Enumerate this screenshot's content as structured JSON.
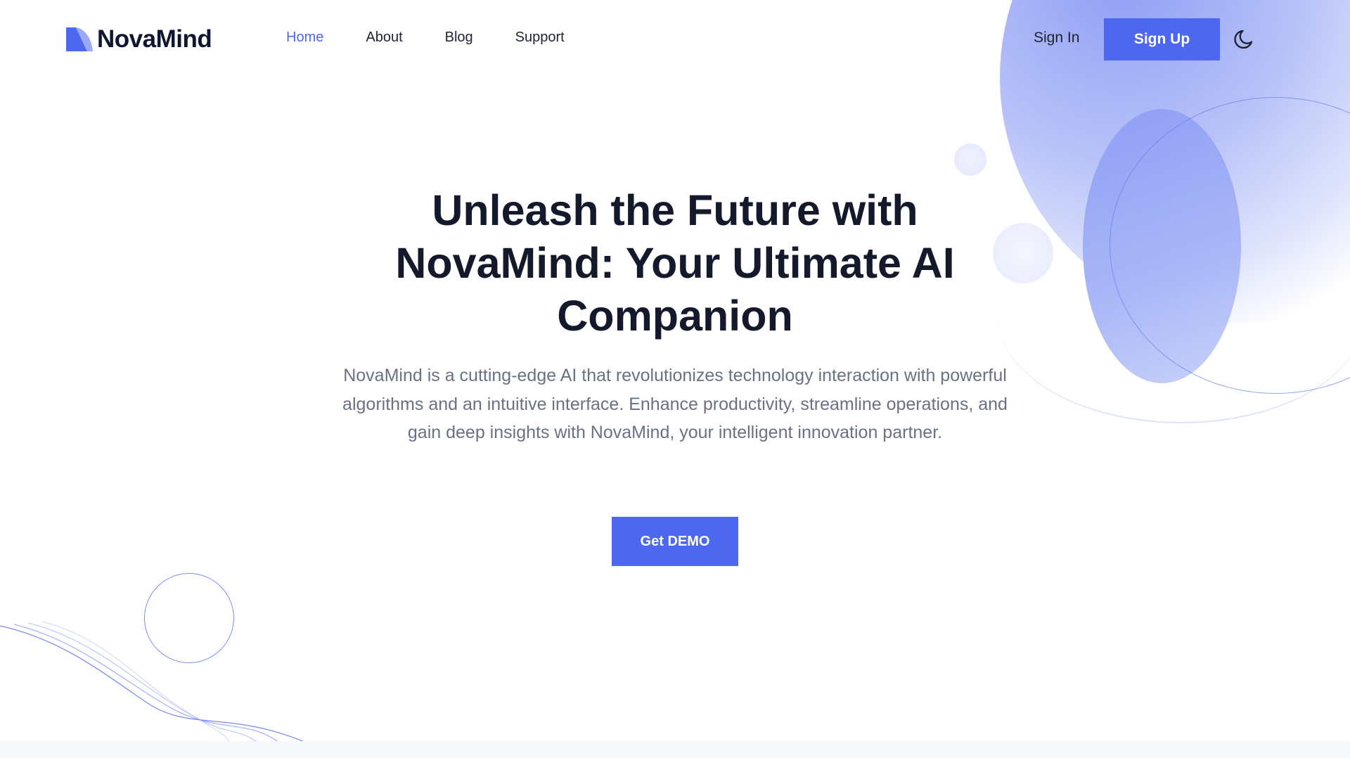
{
  "brand": {
    "name": "NovaMind",
    "logo_icon": "novamind-logo-mark",
    "accent_color": "#4d67ef"
  },
  "nav": {
    "items": [
      {
        "label": "Home",
        "active": true
      },
      {
        "label": "About",
        "active": false
      },
      {
        "label": "Blog",
        "active": false
      },
      {
        "label": "Support",
        "active": false
      }
    ]
  },
  "header_actions": {
    "sign_in": "Sign In",
    "sign_up": "Sign Up",
    "theme_toggle_icon": "moon-icon"
  },
  "hero": {
    "title": "Unleash the Future with NovaMind: Your Ultimate AI Companion",
    "description": "NovaMind is a cutting-edge AI that revolutionizes technology interaction with powerful algorithms and an intuitive interface. Enhance productivity, streamline operations, and gain deep insights with NovaMind, your intelligent innovation partner.",
    "cta": "Get DEMO"
  }
}
